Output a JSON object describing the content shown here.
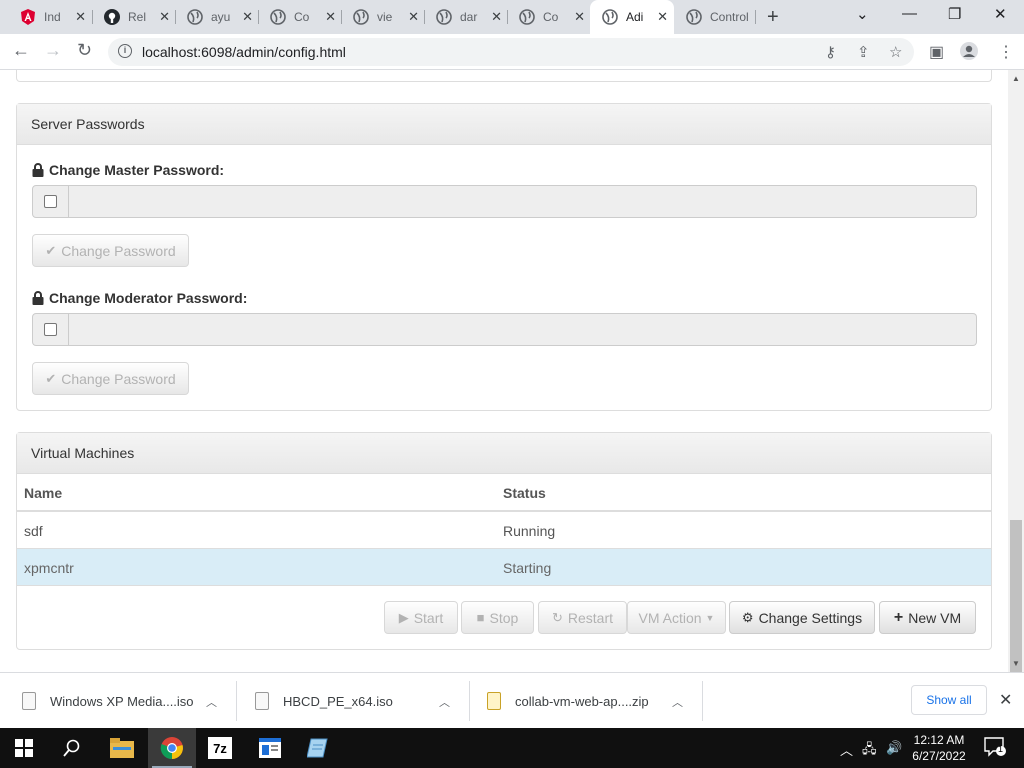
{
  "browser": {
    "tabs": [
      {
        "title": "Ind",
        "icon": "angular-icon"
      },
      {
        "title": "Rel",
        "icon": "github-icon"
      },
      {
        "title": "ayu",
        "icon": "globe-icon"
      },
      {
        "title": "Co",
        "icon": "globe-icon"
      },
      {
        "title": "vie",
        "icon": "globe-icon"
      },
      {
        "title": "dar",
        "icon": "globe-icon"
      },
      {
        "title": "Co",
        "icon": "globe-icon"
      },
      {
        "title": "Adi",
        "icon": "globe-icon",
        "active": true
      },
      {
        "title": "Control",
        "icon": "globe-icon"
      }
    ],
    "url": "localhost:6098/admin/config.html"
  },
  "server_passwords": {
    "heading": "Server Passwords",
    "master": {
      "label": "Change Master Password:",
      "button": "Change Password"
    },
    "moderator": {
      "label": "Change Moderator Password:",
      "button": "Change Password"
    }
  },
  "virtual_machines": {
    "heading": "Virtual Machines",
    "columns": [
      "Name",
      "Status"
    ],
    "rows": [
      {
        "name": "sdf",
        "status": "Running"
      },
      {
        "name": "xpmcntr",
        "status": "Starting",
        "selected": true
      }
    ],
    "buttons": {
      "start": "Start",
      "stop": "Stop",
      "restart": "Restart",
      "vm_action": "VM Action",
      "change_settings": "Change Settings",
      "new_vm": "New VM"
    }
  },
  "downloads": {
    "items": [
      {
        "name": "Windows XP Media....iso"
      },
      {
        "name": "HBCD_PE_x64.iso"
      },
      {
        "name": "collab-vm-web-ap....zip"
      }
    ],
    "show_all": "Show all"
  },
  "taskbar": {
    "time": "12:12 AM",
    "date": "6/27/2022",
    "notifications": "1"
  },
  "colors": {
    "selected_row": "#d9edf7",
    "link_blue": "#1a73e8",
    "taskbar": "#101010"
  }
}
